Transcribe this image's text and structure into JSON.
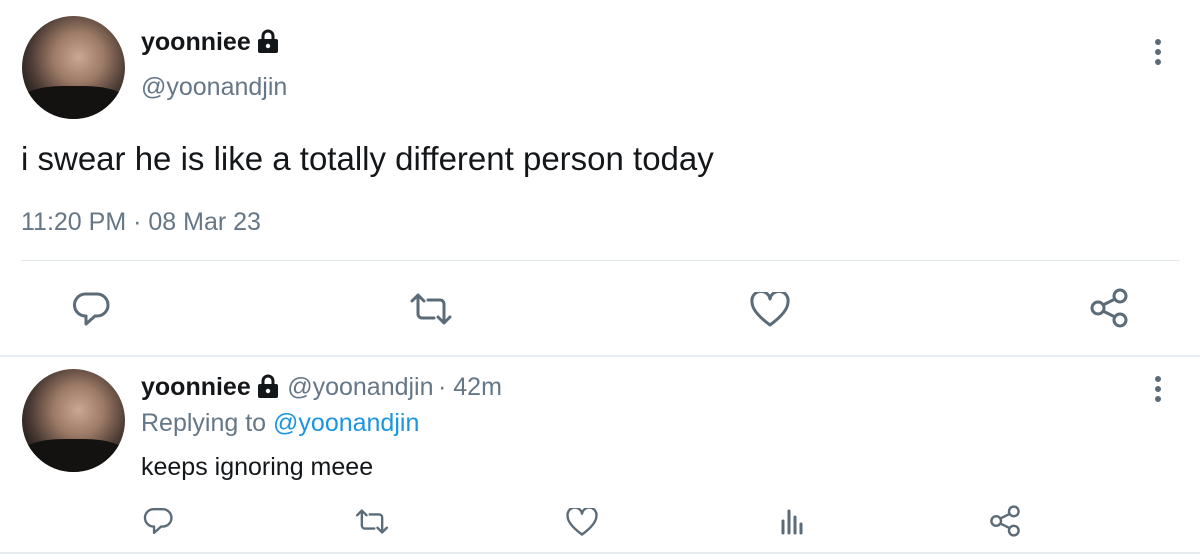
{
  "main_tweet": {
    "display_name": "yoonniee",
    "handle": "@yoonandjin",
    "text": "i swear he is like a totally different person today",
    "time": "11:20 PM",
    "separator": "·",
    "date": "08 Mar 23",
    "icons": [
      "reply-icon",
      "retweet-icon",
      "like-icon",
      "share-icon",
      "more-options-icon",
      "lock-icon"
    ]
  },
  "reply_tweet": {
    "display_name": "yoonniee",
    "handle": "@yoonandjin",
    "age": "· 42m",
    "replying_prefix": "Replying to",
    "replying_to": "@yoonandjin",
    "text": "keeps ignoring meee",
    "icons": [
      "reply-icon",
      "retweet-icon",
      "like-icon",
      "analytics-icon",
      "share-icon",
      "more-options-icon",
      "lock-icon"
    ]
  },
  "colors": {
    "text": "#14171a",
    "secondary": "#657786",
    "link": "#1b95e0",
    "icon": "#5b6b78",
    "divider": "#e1e8ed"
  }
}
